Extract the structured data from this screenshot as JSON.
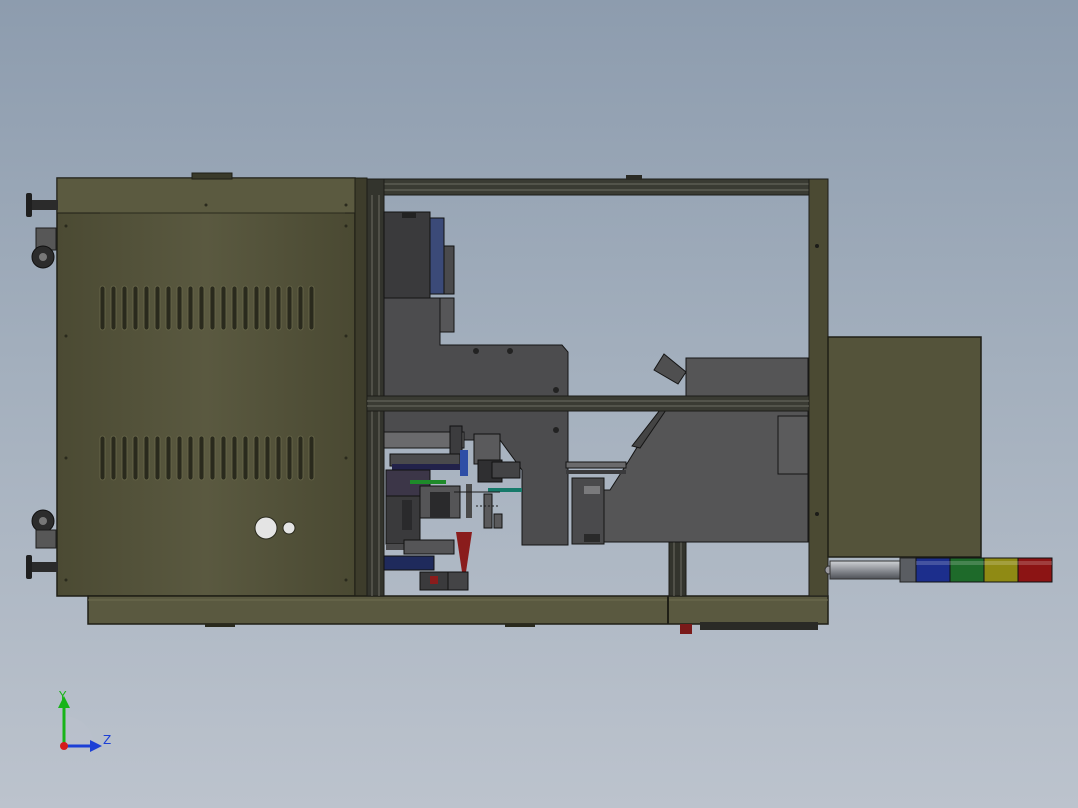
{
  "triad": {
    "y_label": "Y",
    "z_label": "Z"
  },
  "colors": {
    "panel_olive": "#54533a",
    "panel_olive_light": "#6a6948",
    "frame_dark": "#2e2f28",
    "machine_grey": "#4f4f50",
    "axis_green": "#18b418",
    "axis_blue": "#1c3fd6",
    "axis_red": "#d41c1c",
    "light_blue": "#1c2e8c",
    "light_green": "#1e6a2a",
    "light_yellow": "#8f8a14",
    "light_red": "#8c1414"
  },
  "stack_light": [
    "blue",
    "green",
    "yellow",
    "red"
  ]
}
